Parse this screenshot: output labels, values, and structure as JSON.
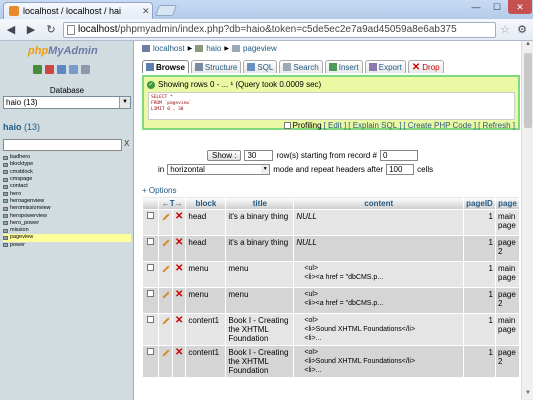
{
  "browser": {
    "tab_title": "localhost / localhost / hai",
    "url_host": "localhost",
    "url_rest": "/phpmyadmin/index.php?db=haio&token=c5de5ec2e7a9ad45059a8e6ab375",
    "colors": {
      "frame": "#c7daf3",
      "close": "#c75050"
    }
  },
  "sidebar": {
    "logo_part1": "php",
    "logo_part2": "MyAdmin",
    "database_label": "Database",
    "database_selected": "haio (13)",
    "db_name": "haio",
    "db_count": "(13)",
    "filter_clear": "X",
    "tables": [
      {
        "name": "badhero"
      },
      {
        "name": "blocktype"
      },
      {
        "name": "cmsblock"
      },
      {
        "name": "cmspage"
      },
      {
        "name": "contact"
      },
      {
        "name": "hero"
      },
      {
        "name": "heroagenview"
      },
      {
        "name": "heromissionview"
      },
      {
        "name": "heropowerview"
      },
      {
        "name": "hero_power"
      },
      {
        "name": "mission"
      },
      {
        "name": "pageview"
      },
      {
        "name": "power"
      }
    ],
    "active_table": "pageview",
    "colors": {
      "background": "#d0dce0",
      "active_row": "#ffff99"
    }
  },
  "breadcrumb": {
    "server": "localhost",
    "database": "haio",
    "table": "pageview"
  },
  "tabs": [
    {
      "label": "Browse",
      "active": true
    },
    {
      "label": "Structure",
      "active": false
    },
    {
      "label": "SQL",
      "active": false
    },
    {
      "label": "Search",
      "active": false
    },
    {
      "label": "Insert",
      "active": false
    },
    {
      "label": "Export",
      "active": false
    },
    {
      "label": "Drop",
      "active": false
    }
  ],
  "message": {
    "text": "Showing rows 0 - ... ¹ (Query took 0.0009 sec)",
    "sql_line1": "SELECT *",
    "sql_line2": "FROM `pageview`",
    "sql_line3": "LIMIT 0 , 30",
    "profiling": "Profiling",
    "edit": "[ Edit ]",
    "explain": "[ Explain SQL ]",
    "create_php": "[ Create PHP Code ]",
    "refresh": "[ Refresh ]",
    "colors": {
      "border": "#7fd97f",
      "background": "#ebf8a4"
    }
  },
  "navigation": {
    "show_button": "Show :",
    "rows_value": "30",
    "rows_text": "row(s) starting from record #",
    "start_value": "0",
    "in_label": "in",
    "mode_value": "horizontal",
    "mode_text": "mode and repeat headers after",
    "repeat_value": "100",
    "cells_text": "cells"
  },
  "options_link": "+ Options",
  "grid": {
    "arrows": "←T→",
    "columns": [
      "block",
      "title",
      "content",
      "pageID",
      "page"
    ],
    "rows": [
      {
        "block": "head",
        "title": "it's a binary thing",
        "content": "NULL",
        "content_null": true,
        "pageID": "1",
        "page": "main page"
      },
      {
        "block": "head",
        "title": "it's a binary thing",
        "content": "NULL",
        "content_null": true,
        "pageID": "1",
        "page": "page 2"
      },
      {
        "block": "menu",
        "title": "menu",
        "content_lines": [
          "<ul>",
          "<li><a href = \"dbCMS.p..."
        ],
        "pageID": "1",
        "page": "main page"
      },
      {
        "block": "menu",
        "title": "menu",
        "content_lines": [
          "<ul>",
          "<li><a href = \"dbCMS.p..."
        ],
        "pageID": "1",
        "page": "page 2"
      },
      {
        "block": "content1",
        "title": "Book I - Creating the XHTML Foundation",
        "content_lines": [
          "<ol>",
          "<li>Sound XHTML Foundations</li>",
          "<li>..."
        ],
        "pageID": "1",
        "page": "main page"
      },
      {
        "block": "content1",
        "title": "Book I - Creating the XHTML Foundation",
        "content_lines": [
          "<ol>",
          "<li>Sound XHTML Foundations</li>",
          "<li>..."
        ],
        "pageID": "1",
        "page": "page 2"
      }
    ]
  }
}
